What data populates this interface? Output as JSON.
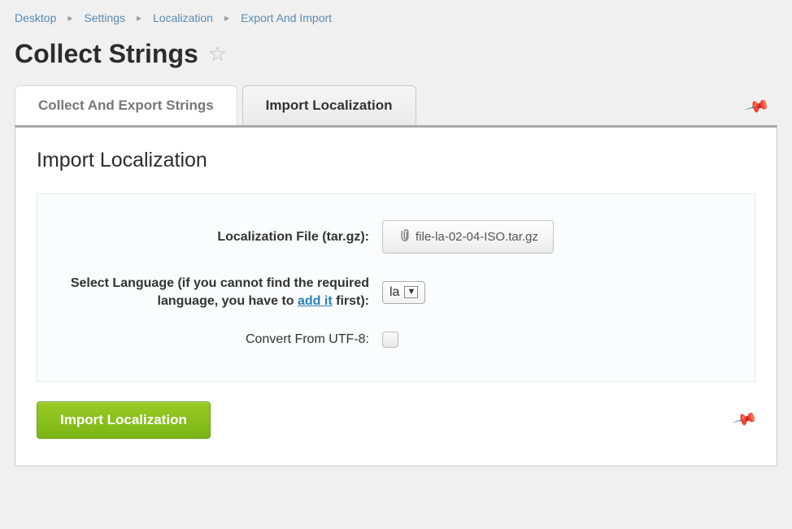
{
  "breadcrumb": {
    "items": [
      {
        "label": "Desktop"
      },
      {
        "label": "Settings"
      },
      {
        "label": "Localization"
      },
      {
        "label": "Export And Import"
      }
    ]
  },
  "page_title": "Collect Strings",
  "tabs": {
    "inactive": "Collect And Export Strings",
    "active": "Import Localization"
  },
  "panel": {
    "heading": "Import Localization",
    "fields": {
      "file": {
        "label": "Localization File (tar.gz):",
        "value": "file-la-02-04-ISO.tar.gz"
      },
      "language": {
        "label_part1": "Select Language (if you cannot find the required language, you have to ",
        "label_link": "add it",
        "label_part2": " first):",
        "value": "la"
      },
      "convert": {
        "label": "Convert From UTF-8:",
        "checked": false
      }
    },
    "submit_label": "Import Localization"
  }
}
